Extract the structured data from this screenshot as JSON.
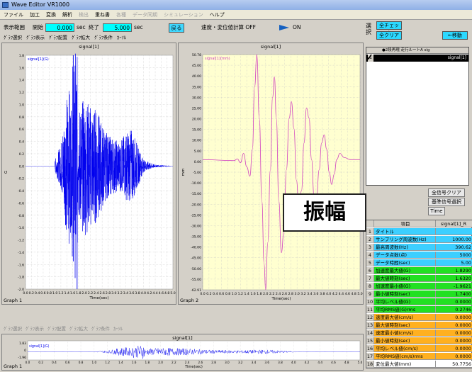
{
  "window": {
    "title": "Wave Editor VR1000"
  },
  "menu": [
    {
      "label": "ファイル",
      "enabled": true
    },
    {
      "label": "加工",
      "enabled": true
    },
    {
      "label": "変換",
      "enabled": true
    },
    {
      "label": "解析",
      "enabled": true
    },
    {
      "label": "検出",
      "enabled": false
    },
    {
      "label": "重ね書",
      "enabled": true
    },
    {
      "label": "各種",
      "enabled": false
    },
    {
      "label": "データ同期",
      "enabled": false
    },
    {
      "label": "シミュレーション",
      "enabled": false
    },
    {
      "label": "ヘルプ",
      "enabled": true
    }
  ],
  "range": {
    "label": "表示範囲",
    "start_label": "開始",
    "start_value": "0.000",
    "sec1": "sec",
    "end_label": "終了",
    "end_value": "5.000",
    "sec2": "sec",
    "back_button": "戻る",
    "calc_label": "速度・変位値計算 OFF",
    "calc_on": "ON"
  },
  "graph_toolbar": [
    "ｸﾞﾗﾌ選択",
    "ｸﾞﾗﾌ表示",
    "ｸﾞﾗﾌ配置",
    "ｸﾞﾗﾌ拡大",
    "ｸﾞﾗﾌ条件",
    "ｶｰｿﾙ"
  ],
  "graph_toolbar2": [
    "ｸﾞﾗﾌ選択",
    "ｸﾞﾗﾌ表示",
    "ｸﾞﾗﾌ配置",
    "ｸﾞﾗﾌ拡大",
    "ｸﾞﾗﾌ条件",
    "ｶｰｿﾙ"
  ],
  "graph1": {
    "panel_title": "signal[1]",
    "legend": "signal[1](G)",
    "footer": "Graph 1",
    "ylabel": "G",
    "xlabel": "Time(sec)"
  },
  "graph2": {
    "panel_title": "signal[1]",
    "legend": "signal[1](mm)",
    "footer": "Graph 2",
    "ylabel": "mm",
    "xlabel": "Time(sec)"
  },
  "graph3": {
    "panel_title": "signal[1]",
    "legend": "signal[1](G)",
    "footer": "Graph 1",
    "xlabel": "Time(sec)",
    "yticks": [
      "1.83",
      "0",
      "-1.96"
    ]
  },
  "chart_data": [
    {
      "type": "line",
      "title": "",
      "series": [
        {
          "name": "signal[1](G)",
          "color": "#0000ee"
        }
      ],
      "xlabel": "Time(sec)",
      "ylabel": "G",
      "xlim": [
        0,
        5
      ],
      "ylim": [
        -2.0,
        1.8
      ],
      "xticks": [
        "0.0",
        "0.2",
        "0.4",
        "0.6",
        "0.8",
        "1.0",
        "1.2",
        "1.4",
        "1.6",
        "1.8",
        "2.0",
        "2.2",
        "2.4",
        "2.6",
        "2.8",
        "3.0",
        "3.2",
        "3.4",
        "3.6",
        "3.8",
        "4.0",
        "4.2",
        "4.4",
        "4.6",
        "4.8",
        "5.0"
      ],
      "yticks": [
        "1.8",
        "1.6",
        "1.4",
        "1.2",
        "1.0",
        "0.8",
        "0.6",
        "0.4",
        "0.2",
        "0.0",
        "-0.2",
        "-0.4",
        "-0.6",
        "-0.8",
        "-1.0",
        "-1.2",
        "-1.4",
        "-1.6",
        "-1.8",
        "-2.0"
      ],
      "envelope": [
        [
          1.0,
          0.1
        ],
        [
          1.2,
          0.35
        ],
        [
          1.4,
          1.15
        ],
        [
          1.5,
          1.3
        ],
        [
          1.55,
          0.9
        ],
        [
          1.6,
          1.8
        ],
        [
          1.62,
          -1.55
        ],
        [
          1.7,
          -1.9
        ],
        [
          1.75,
          -2.0
        ],
        [
          1.8,
          0.9
        ],
        [
          2.0,
          1.15
        ],
        [
          2.2,
          1.0
        ],
        [
          2.4,
          0.95
        ],
        [
          2.6,
          0.7
        ],
        [
          2.8,
          0.5
        ],
        [
          3.0,
          0.45
        ],
        [
          3.2,
          0.4
        ],
        [
          3.4,
          0.55
        ],
        [
          3.6,
          0.6
        ],
        [
          3.8,
          0.35
        ],
        [
          4.0,
          0.1
        ],
        [
          4.4,
          0.02
        ],
        [
          5.0,
          0.0
        ]
      ],
      "grid": true
    },
    {
      "type": "line",
      "title": "",
      "series": [
        {
          "name": "signal[1](mm)",
          "color": "#d040c0"
        }
      ],
      "xlabel": "Time(sec)",
      "ylabel": "mm",
      "xlim": [
        0,
        5
      ],
      "ylim": [
        -62.91,
        50.78
      ],
      "xticks": [
        "0.0",
        "0.2",
        "0.4",
        "0.6",
        "0.8",
        "1.0",
        "1.2",
        "1.4",
        "1.6",
        "1.8",
        "2.0",
        "2.2",
        "2.4",
        "2.6",
        "2.8",
        "3.0",
        "3.2",
        "3.4",
        "3.6",
        "3.8",
        "4.0",
        "4.2",
        "4.4",
        "4.6",
        "4.8",
        "5.0"
      ],
      "yticks": [
        "50.78",
        "45.00",
        "40.00",
        "35.00",
        "30.00",
        "25.00",
        "20.00",
        "15.00",
        "10.00",
        "5.00",
        "0.00",
        "-5.00",
        "-10.00",
        "-15.00",
        "-20.00",
        "-25.00",
        "-30.00",
        "-35.00",
        "-40.00",
        "-45.00",
        "-50.00",
        "-55.00",
        "-62.91"
      ],
      "points": [
        [
          0,
          0
        ],
        [
          1.0,
          -0.5
        ],
        [
          1.1,
          0.4
        ],
        [
          1.2,
          -1.5
        ],
        [
          1.3,
          3.0
        ],
        [
          1.4,
          -3.5
        ],
        [
          1.5,
          -8.0
        ],
        [
          1.58,
          5.0
        ],
        [
          1.65,
          35.0
        ],
        [
          1.72,
          50.78
        ],
        [
          1.8,
          20.0
        ],
        [
          1.88,
          -20.0
        ],
        [
          1.95,
          -50.0
        ],
        [
          2.0,
          -62.91
        ],
        [
          2.07,
          -40.0
        ],
        [
          2.15,
          -5.0
        ],
        [
          2.22,
          30.0
        ],
        [
          2.28,
          40.0
        ],
        [
          2.34,
          20.0
        ],
        [
          2.42,
          -20.0
        ],
        [
          2.5,
          -45.0
        ],
        [
          2.58,
          -35.0
        ],
        [
          2.66,
          -5.0
        ],
        [
          2.75,
          20.0
        ],
        [
          2.82,
          28.0
        ],
        [
          2.9,
          15.0
        ],
        [
          2.98,
          -10.0
        ],
        [
          3.06,
          -25.0
        ],
        [
          3.14,
          -15.0
        ],
        [
          3.22,
          8.0
        ],
        [
          3.3,
          25.0
        ],
        [
          3.38,
          20.0
        ],
        [
          3.46,
          0.0
        ],
        [
          3.54,
          -18.0
        ],
        [
          3.62,
          -18.0
        ],
        [
          3.7,
          -5.0
        ],
        [
          3.78,
          8.0
        ],
        [
          3.86,
          12.0
        ],
        [
          3.94,
          5.0
        ],
        [
          4.02,
          -6.0
        ],
        [
          4.1,
          -12.0
        ],
        [
          4.18,
          -7.0
        ],
        [
          4.26,
          0.0
        ],
        [
          4.36,
          3.0
        ],
        [
          4.5,
          1.0
        ],
        [
          4.7,
          0.0
        ],
        [
          5.0,
          0.0
        ]
      ],
      "grid": true
    }
  ],
  "selection": {
    "label": "選択",
    "all_check": "全チェック",
    "all_clear": "全クリア",
    "move_button": "←移動",
    "table_header": "●2段再現 走行ルートA sig",
    "row1_num": "1",
    "row1_name": "signal[1]"
  },
  "signal_buttons": {
    "clear": "全信号クリア",
    "ref_select": "基準信号選択",
    "time": "Time"
  },
  "props": {
    "header_name": "項目",
    "header_val": "signal[1]_R",
    "rows": [
      {
        "num": "1",
        "name": "タイトル",
        "val": "",
        "color": "#3ccfff"
      },
      {
        "num": "2",
        "name": "サンプリング周波数(Hz)",
        "val": "1000.00",
        "color": "#3ccfff"
      },
      {
        "num": "3",
        "name": "最高周波数(Hz)",
        "val": "390.62",
        "color": "#3ccfff"
      },
      {
        "num": "4",
        "name": "データ点数(点)",
        "val": "5000",
        "color": "#3ccfff"
      },
      {
        "num": "5",
        "name": "データ時間(sec)",
        "val": "5.00",
        "color": "#3ccfff"
      },
      {
        "num": "6",
        "name": "加速度最大値(G)",
        "val": "1.8290",
        "color": "#22e022"
      },
      {
        "num": "7",
        "name": "最大値時刻(sec)",
        "val": "1.6320",
        "color": "#22e022"
      },
      {
        "num": "8",
        "name": "加速度最小値(G)",
        "val": "-1.9621",
        "color": "#22e022"
      },
      {
        "num": "9",
        "name": "最小値時刻(sec)",
        "val": "1.7400",
        "color": "#22e022"
      },
      {
        "num": "10",
        "name": "平均レベル値(G)",
        "val": "0.0000",
        "color": "#22e022"
      },
      {
        "num": "11",
        "name": "平均RMS値(G)rms",
        "val": "0.2746",
        "color": "#22e022"
      },
      {
        "num": "12",
        "name": "速度最大値(cm/s)",
        "val": "0.0000",
        "color": "#ffb020"
      },
      {
        "num": "13",
        "name": "最大値時刻(sec)",
        "val": "0.0000",
        "color": "#ffb020"
      },
      {
        "num": "14",
        "name": "速度最小値(cm/s)",
        "val": "0.0000",
        "color": "#ffb020"
      },
      {
        "num": "15",
        "name": "最小値時刻(sec)",
        "val": "0.0000",
        "color": "#ffb020"
      },
      {
        "num": "16",
        "name": "平均レベル値(cm/s)",
        "val": "0.0000",
        "color": "#ffb020"
      },
      {
        "num": "17",
        "name": "平均RMS値(cm/s)rms",
        "val": "0.0000",
        "color": "#ffb020"
      },
      {
        "num": "18",
        "name": "変位最大値(mm)",
        "val": "50.7756",
        "color": "#ffffff"
      }
    ]
  },
  "callout": {
    "text": "振幅"
  }
}
